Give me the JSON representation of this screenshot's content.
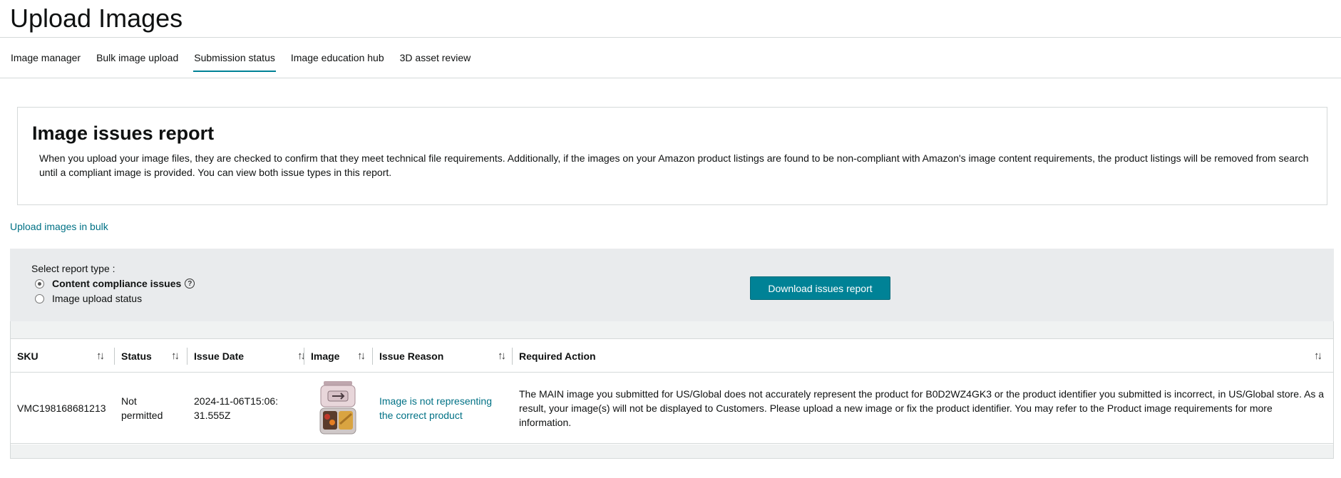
{
  "page": {
    "title": "Upload Images"
  },
  "tabs": [
    {
      "label": "Image manager"
    },
    {
      "label": "Bulk image upload"
    },
    {
      "label": "Submission status"
    },
    {
      "label": "Image education hub"
    },
    {
      "label": "3D asset review"
    }
  ],
  "report": {
    "title": "Image issues report",
    "description": "When you upload your image files, they are checked to confirm that they meet technical file requirements. Additionally, if the images on your Amazon product listings are found to be non-compliant with Amazon's image content requirements, the product listings will be removed from search until a compliant image is provided. You can view both issue types in this report."
  },
  "bulk_link": "Upload images in bulk",
  "controls": {
    "select_label": "Select report type :",
    "options": [
      {
        "label": "Content compliance issues",
        "selected": true
      },
      {
        "label": "Image upload status",
        "selected": false
      }
    ],
    "help_icon": "help-icon",
    "download_label": "Download issues report"
  },
  "table": {
    "columns": [
      {
        "label": "SKU"
      },
      {
        "label": "Status"
      },
      {
        "label": "Issue Date"
      },
      {
        "label": "Image"
      },
      {
        "label": "Issue Reason"
      },
      {
        "label": "Required Action"
      }
    ],
    "rows": [
      {
        "sku": "VMC198168681213",
        "status": "Not permitted",
        "issue_date": "2024-11-06T15:06:31.555Z",
        "image": "product-thumbnail",
        "issue_reason": "Image is not representing the correct product",
        "required_action": "The MAIN image you submitted for US/Global does not accurately represent the product for B0D2WZ4GK3 or the product identifier you submitted is incorrect, in US/Global store. As a result, your image(s) will not be displayed to Customers. Please upload a new image or fix the product identifier. You may refer to the Product image requirements for more information."
      }
    ]
  },
  "colors": {
    "accent": "#008296",
    "link": "#007185",
    "panel": "#e9ebed"
  }
}
